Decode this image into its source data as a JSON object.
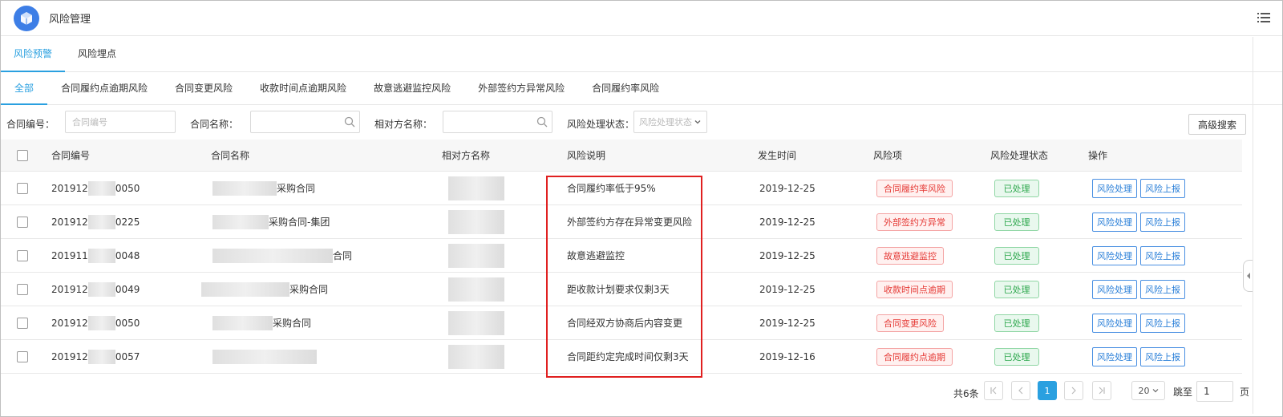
{
  "app": {
    "title": "风险管理"
  },
  "main_tabs": [
    {
      "label": "风险预警",
      "active": true
    },
    {
      "label": "风险埋点",
      "active": false
    }
  ],
  "sub_tabs": [
    {
      "label": "全部",
      "active": true
    },
    {
      "label": "合同履约点逾期风险"
    },
    {
      "label": "合同变更风险"
    },
    {
      "label": "收款时间点逾期风险"
    },
    {
      "label": "故意逃避监控风险"
    },
    {
      "label": "外部签约方异常风险"
    },
    {
      "label": "合同履约率风险"
    }
  ],
  "filters": {
    "contract_no_label": "合同编号：",
    "contract_no_placeholder": "合同编号",
    "contract_name_label": "合同名称：",
    "contract_name_value": "",
    "counterparty_label": "相对方名称：",
    "counterparty_value": "",
    "status_label": "风险处理状态：",
    "status_placeholder": "风险处理状态",
    "advanced_search": "高级搜索"
  },
  "table": {
    "headers": [
      "合同编号",
      "合同名称",
      "相对方名称",
      "风险说明",
      "发生时间",
      "风险项",
      "风险处理状态",
      "操作"
    ],
    "rows": [
      {
        "no_prefix": "201912",
        "no_suffix": "0050",
        "name_suffix": "采购合同",
        "desc": "合同履约率低于95%",
        "date": "2019-12-25",
        "risk": "合同履约率风险",
        "status": "已处理"
      },
      {
        "no_prefix": "201912",
        "no_suffix": "0225",
        "name_suffix": "采购合同-集团",
        "desc": "外部签约方存在异常变更风险",
        "date": "2019-12-25",
        "risk": "外部签约方异常",
        "status": "已处理"
      },
      {
        "no_prefix": "201911",
        "no_suffix": "0048",
        "name_suffix": "合同",
        "desc": "故意逃避监控",
        "date": "2019-12-25",
        "risk": "故意逃避监控",
        "status": "已处理"
      },
      {
        "no_prefix": "201912",
        "no_suffix": "0049",
        "name_suffix": "采购合同",
        "desc": "距收款计划要求仅剩3天",
        "date": "2019-12-25",
        "risk": "收款时间点逾期",
        "status": "已处理"
      },
      {
        "no_prefix": "201912",
        "no_suffix": "0050",
        "name_suffix": "采购合同",
        "desc": "合同经双方协商后内容变更",
        "date": "2019-12-25",
        "risk": "合同变更风险",
        "status": "已处理"
      },
      {
        "no_prefix": "201912",
        "no_suffix": "0057",
        "name_suffix": "",
        "desc": "合同距约定完成时间仅剩3天",
        "date": "2019-12-16",
        "risk": "合同履约点逾期",
        "status": "已处理"
      }
    ],
    "actions": {
      "handle": "风险处理",
      "report": "风险上报"
    }
  },
  "pagination": {
    "total": "共6条",
    "current_page": "1",
    "page_size": "20",
    "goto_label": "跳至",
    "goto_value": "1",
    "page_unit": "页"
  },
  "colors": {
    "accent": "#2aa0e0",
    "danger": "#e53935",
    "success": "#2ea84e",
    "highlight_box": "#e02020"
  }
}
